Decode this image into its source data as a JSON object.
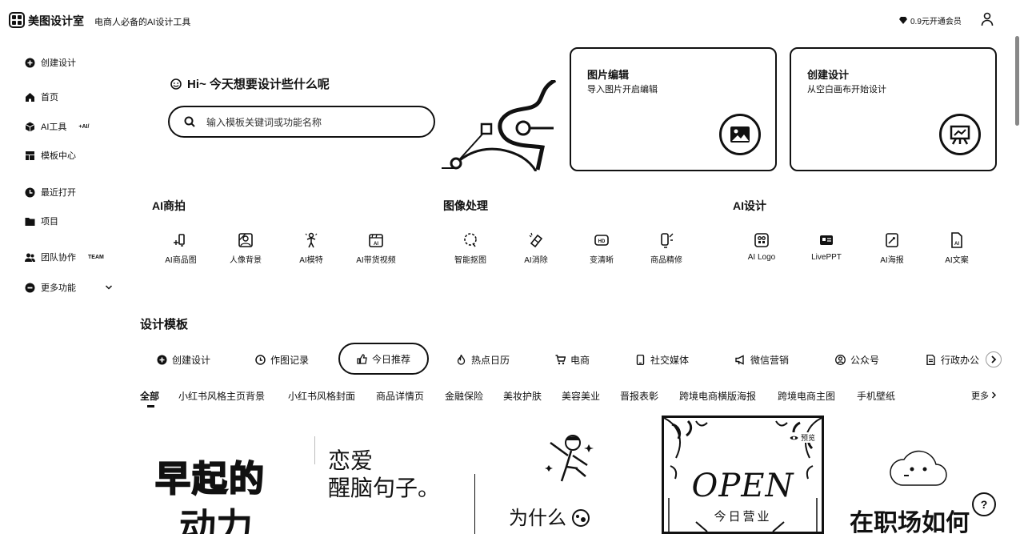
{
  "header": {
    "app_name": "美图设计室",
    "tagline": "电商人必备的AI设计工具",
    "vip_label": "0.9元开通会员"
  },
  "sidebar": {
    "items": [
      {
        "label": "创建设计",
        "icon": "plus-circle-icon"
      },
      {
        "label": "首页",
        "icon": "home-icon"
      },
      {
        "label": "AI工具",
        "icon": "ai-cube-icon",
        "badge": "+AI/"
      },
      {
        "label": "模板中心",
        "icon": "template-icon"
      },
      {
        "label": "最近打开",
        "icon": "clock-icon"
      },
      {
        "label": "项目",
        "icon": "folder-icon"
      },
      {
        "label": "团队协作",
        "icon": "team-icon",
        "badge": "TEAM"
      },
      {
        "label": "更多功能",
        "icon": "more-icon"
      }
    ]
  },
  "hero": {
    "greeting": "Hi~ 今天想要设计些什么呢",
    "search_placeholder": "输入模板关键词或功能名称",
    "cards": [
      {
        "title": "图片编辑",
        "subtitle": "导入图片开启编辑",
        "icon": "image-icon"
      },
      {
        "title": "创建设计",
        "subtitle": "从空白画布开始设计",
        "icon": "canvas-icon"
      }
    ]
  },
  "tool_sections": [
    {
      "title": "AI商拍",
      "tools": [
        {
          "label": "AI商品图",
          "icon": "ai-product-icon"
        },
        {
          "label": "人像背景",
          "icon": "portrait-bg-icon"
        },
        {
          "label": "AI模特",
          "icon": "ai-model-icon"
        },
        {
          "label": "AI带货视频",
          "icon": "ai-video-icon"
        }
      ]
    },
    {
      "title": "图像处理",
      "tools": [
        {
          "label": "智能抠图",
          "icon": "cutout-icon"
        },
        {
          "label": "AI消除",
          "icon": "eraser-icon"
        },
        {
          "label": "变清晰",
          "icon": "hd-icon"
        },
        {
          "label": "商品精修",
          "icon": "retouch-icon"
        }
      ]
    },
    {
      "title": "AI设计",
      "tools": [
        {
          "label": "AI Logo",
          "icon": "logo-icon"
        },
        {
          "label": "LivePPT",
          "icon": "ppt-icon"
        },
        {
          "label": "AI海报",
          "icon": "poster-icon"
        },
        {
          "label": "AI文案",
          "icon": "copywriting-icon"
        }
      ]
    }
  ],
  "templates": {
    "title": "设计模板",
    "tabs": [
      {
        "label": "创建设计",
        "icon": "plus-circle-icon"
      },
      {
        "label": "作图记录",
        "icon": "clock-icon"
      },
      {
        "label": "今日推荐",
        "icon": "thumbs-up-icon"
      },
      {
        "label": "热点日历",
        "icon": "flame-icon"
      },
      {
        "label": "电商",
        "icon": "cart-icon"
      },
      {
        "label": "社交媒体",
        "icon": "phone-icon"
      },
      {
        "label": "微信营销",
        "icon": "megaphone-icon"
      },
      {
        "label": "公众号",
        "icon": "account-icon"
      },
      {
        "label": "行政办公",
        "icon": "document-icon"
      }
    ],
    "categories": [
      "全部",
      "小红书风格主页背景",
      "小红书风格封面",
      "商品详情页",
      "金融保险",
      "美妆护肤",
      "美容美业",
      "晋报表彰",
      "跨境电商横版海报",
      "跨境电商主图",
      "手机壁纸"
    ],
    "more_label": "更多",
    "thumbs": [
      {
        "text1": "早起的",
        "text2": "动力"
      },
      {
        "text1": "恋爱",
        "text2": "醒脑句子。"
      },
      {
        "text1": "为什么"
      },
      {
        "text1": "OPEN",
        "text2": "今日营业",
        "badge": "预览"
      },
      {
        "text1": "在职场如何"
      }
    ]
  },
  "help_label": "?"
}
